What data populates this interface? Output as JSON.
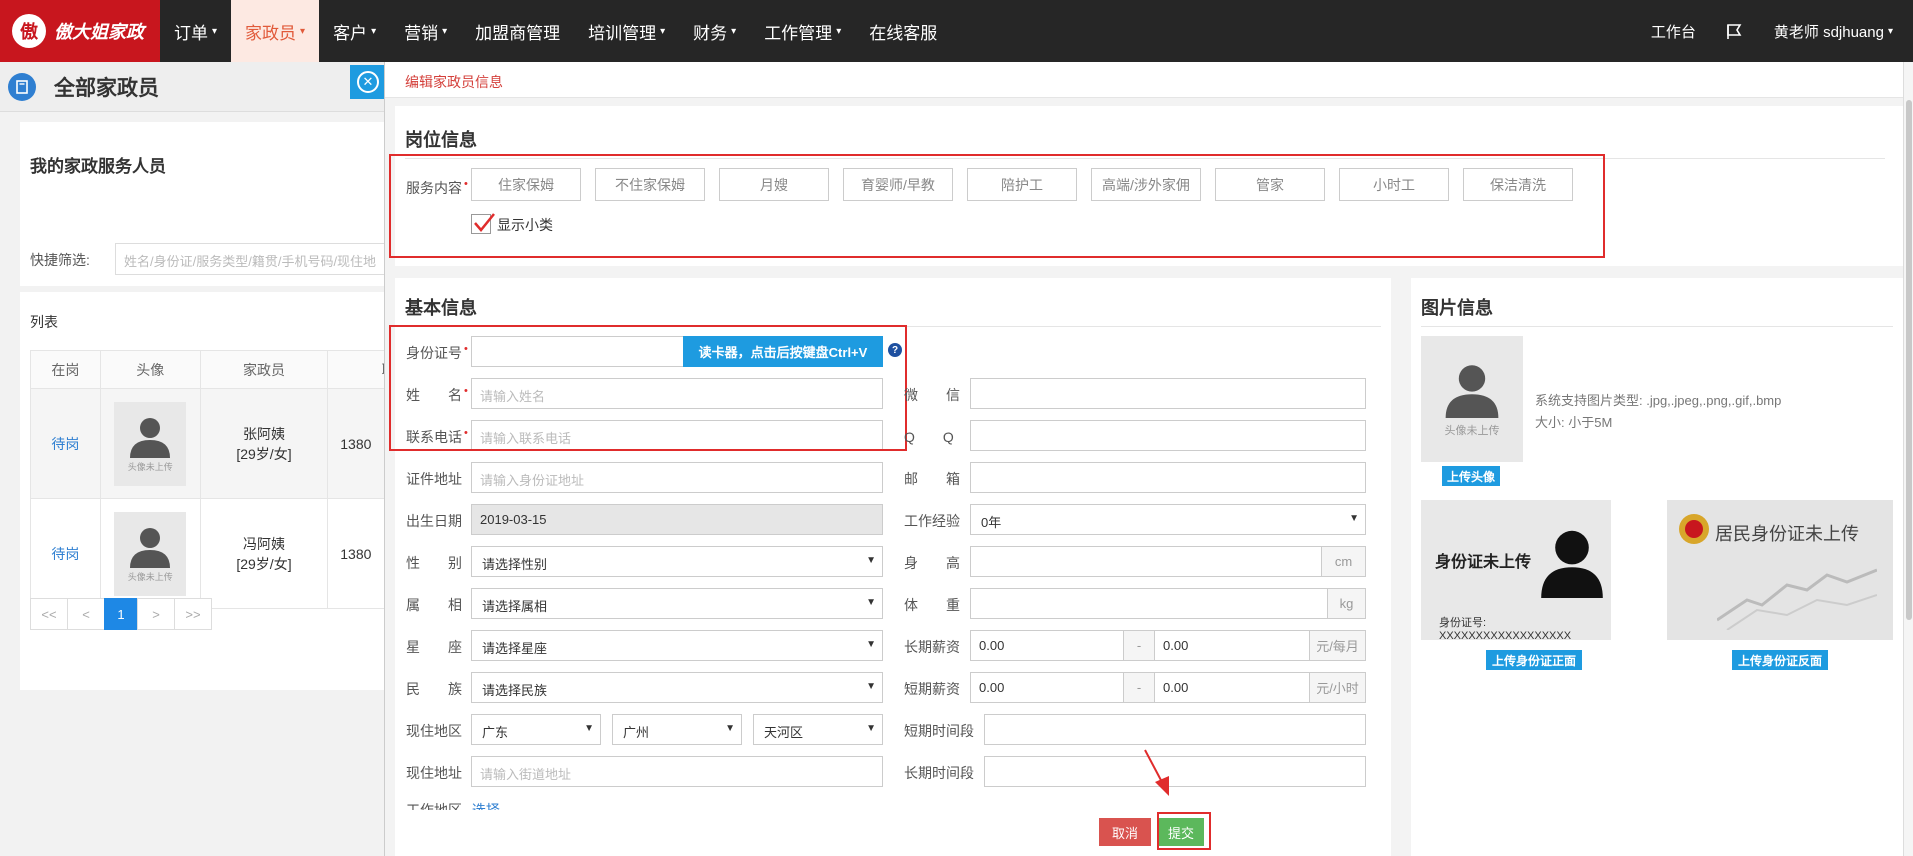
{
  "topnav": {
    "logo_char": "傲",
    "logo_text": "傲大姐家政",
    "menu": [
      {
        "label": "订单",
        "caret": "▾",
        "active": false
      },
      {
        "label": "家政员",
        "caret": "▾",
        "active": true
      },
      {
        "label": "客户",
        "caret": "▾",
        "active": false
      },
      {
        "label": "营销",
        "caret": "▾",
        "active": false
      },
      {
        "label": "加盟商管理",
        "caret": "",
        "active": false
      },
      {
        "label": "培训管理",
        "caret": "▾",
        "active": false
      },
      {
        "label": "财务",
        "caret": "▾",
        "active": false
      },
      {
        "label": "工作管理",
        "caret": "▾",
        "active": false
      },
      {
        "label": "在线客服",
        "caret": "",
        "active": false
      }
    ],
    "workbench": "工作台",
    "user": "黄老师  sdjhuang",
    "user_caret": "▾"
  },
  "leftpage": {
    "title": "全部家政员",
    "panel_title": "我的家政服务人员",
    "filter_label": "快捷筛选:",
    "filter_placeholder": "姓名/身份证/服务类型/籍贯/手机号码/现住地",
    "list_title": "列表",
    "columns": [
      "在岗",
      "头像",
      "家政员",
      "联"
    ],
    "rows": [
      {
        "status": "待岗",
        "avatar_caption": "头像未上传",
        "name": "张阿姨",
        "info": "[29岁/女]",
        "phone": "1380"
      },
      {
        "status": "待岗",
        "avatar_caption": "头像未上传",
        "name": "冯阿姨",
        "info": "[29岁/女]",
        "phone": "1380"
      }
    ],
    "pager": [
      "<<",
      "<",
      "1",
      ">",
      ">>"
    ]
  },
  "modal": {
    "title": "编辑家政员信息",
    "post_section": {
      "title": "岗位信息",
      "service_label": "服务内容",
      "required_mark": "•",
      "services": [
        "住家保姆",
        "不住家保姆",
        "月嫂",
        "育婴师/早教",
        "陪护工",
        "高端/涉外家佣",
        "管家",
        "小时工",
        "保洁清洗"
      ],
      "show_sub_label": "显示小类",
      "show_sub_checked": true
    },
    "basic_section": {
      "title": "基本信息",
      "id_label": "身份证号",
      "id_value": "",
      "read_card_label": "读卡器，点击后按键盘Ctrl+V",
      "help_mark": "?",
      "name_label": "姓　　名",
      "name_placeholder": "请输入姓名",
      "phone_label": "联系电话",
      "phone_placeholder": "请输入联系电话",
      "id_addr_label": "证件地址",
      "id_addr_placeholder": "请输入身份证地址",
      "birth_label": "出生日期",
      "birth_value": "2019-03-15",
      "gender_label": "性　　别",
      "gender_value": "请选择性别",
      "zodiac_label": "属　　相",
      "zodiac_value": "请选择属相",
      "star_label": "星　　座",
      "star_value": "请选择星座",
      "nation_label": "民　　族",
      "nation_value": "请选择民族",
      "region_label": "现住地区",
      "province": "广东",
      "city": "广州",
      "district": "天河区",
      "address_label": "现住地址",
      "address_placeholder": "请输入街道地址",
      "work_area_label": "工作地区",
      "work_area_link": "选择",
      "wechat_label": "微　　信",
      "qq_label": "Q　　Q",
      "email_label": "邮　　箱",
      "experience_label": "工作经验",
      "experience_value": "0年",
      "height_label": "身　　高",
      "height_unit": "cm",
      "weight_label": "体　　重",
      "weight_unit": "kg",
      "long_salary_label": "长期薪资",
      "long_salary_min": "0.00",
      "long_salary_max": "0.00",
      "long_salary_unit": "元/每月",
      "short_salary_label": "短期薪资",
      "short_salary_min": "0.00",
      "short_salary_max": "0.00",
      "short_salary_unit": "元/小时",
      "range_sep": "-",
      "short_time_label": "短期时间段",
      "long_time_label": "长期时间段"
    },
    "image_section": {
      "title": "图片信息",
      "avatar_caption": "头像未上传",
      "support_types": "系统支持图片类型: .jpg,.jpeg,.png,.gif,.bmp",
      "size_limit": "大小: 小于5M",
      "upload_avatar": "上传头像",
      "id_front_title": "身份证未上传",
      "id_front_number": "身份证号: XXXXXXXXXXXXXXXXXX",
      "id_back_title": "居民身份证未上传",
      "upload_front": "上传身份证正面",
      "upload_back": "上传身份证反面"
    },
    "buttons": {
      "cancel": "取消",
      "submit": "提交"
    }
  },
  "colors": {
    "brand_red": "#c8161e",
    "accent_blue": "#1e9be0",
    "annotation_red": "#e02c2c",
    "submit_green": "#5cb85c",
    "cancel_red": "#d9534f"
  }
}
